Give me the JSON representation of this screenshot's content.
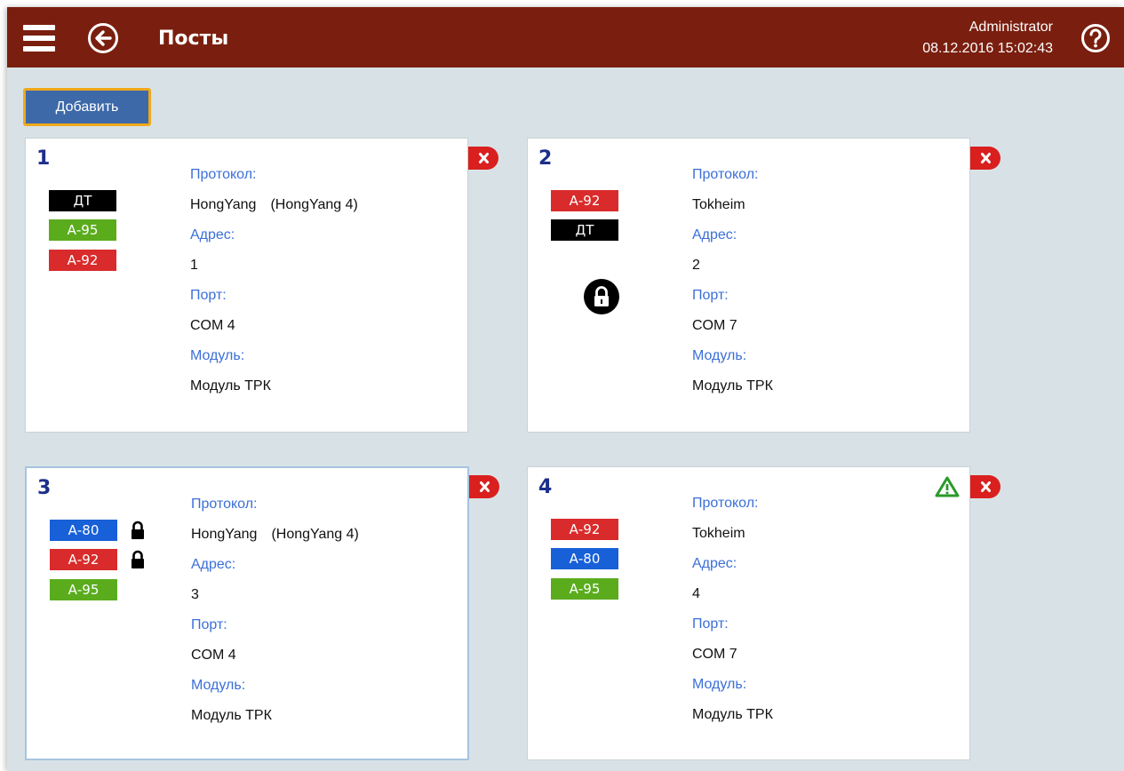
{
  "header": {
    "title": "Посты",
    "user": "Administrator",
    "datetime": "08.12.2016 15:02:43",
    "menu_icon": "hamburger-menu-icon",
    "back_icon": "arrow-left-circle-icon",
    "help_icon": "question-circle-icon"
  },
  "toolbar": {
    "add_label": "Добавить"
  },
  "labels": {
    "protocol": "Протокол:",
    "address": "Адрес:",
    "port": "Порт:",
    "module": "Модуль:"
  },
  "colors": {
    "header_bg": "#7a1f0f",
    "page_bg": "#d8e2e6",
    "label_blue": "#3b6fd8",
    "number_blue": "#1c2f8a",
    "fuel_dt": "#000000",
    "fuel_a95": "#5aac1d",
    "fuel_a92": "#d92b2b",
    "fuel_a80": "#1860d8",
    "delete_red": "#d9201e",
    "warning_green": "#2a9a2a",
    "add_button": "#3e69a8",
    "add_button_border": "#f0a81c"
  },
  "posts": [
    {
      "number": "1",
      "fuels": [
        {
          "name": "ДТ",
          "color": "#000000",
          "locked": false
        },
        {
          "name": "А-95",
          "color": "#5aac1d",
          "locked": false
        },
        {
          "name": "А-92",
          "color": "#d92b2b",
          "locked": false
        }
      ],
      "post_locked": false,
      "warning": false,
      "protocol": "HongYang",
      "protocol_detail": "(HongYang 4)",
      "address": "1",
      "port": "COM 4",
      "module": "Модуль ТРК"
    },
    {
      "number": "2",
      "fuels": [
        {
          "name": "А-92",
          "color": "#d92b2b",
          "locked": false
        },
        {
          "name": "ДТ",
          "color": "#000000",
          "locked": false
        }
      ],
      "post_locked": true,
      "warning": false,
      "protocol": "Tokheim",
      "protocol_detail": "",
      "address": "2",
      "port": "COM 7",
      "module": "Модуль ТРК"
    },
    {
      "number": "3",
      "fuels": [
        {
          "name": "А-80",
          "color": "#1860d8",
          "locked": true
        },
        {
          "name": "А-92",
          "color": "#d92b2b",
          "locked": true
        },
        {
          "name": "А-95",
          "color": "#5aac1d",
          "locked": false
        }
      ],
      "post_locked": false,
      "warning": false,
      "protocol": "HongYang",
      "protocol_detail": "(HongYang 4)",
      "address": "3",
      "port": "COM 4",
      "module": "Модуль ТРК"
    },
    {
      "number": "4",
      "fuels": [
        {
          "name": "А-92",
          "color": "#d92b2b",
          "locked": false
        },
        {
          "name": "А-80",
          "color": "#1860d8",
          "locked": false
        },
        {
          "name": "А-95",
          "color": "#5aac1d",
          "locked": false
        }
      ],
      "post_locked": false,
      "warning": true,
      "protocol": "Tokheim",
      "protocol_detail": "",
      "address": "4",
      "port": "COM 7",
      "module": "Модуль ТРК"
    }
  ]
}
